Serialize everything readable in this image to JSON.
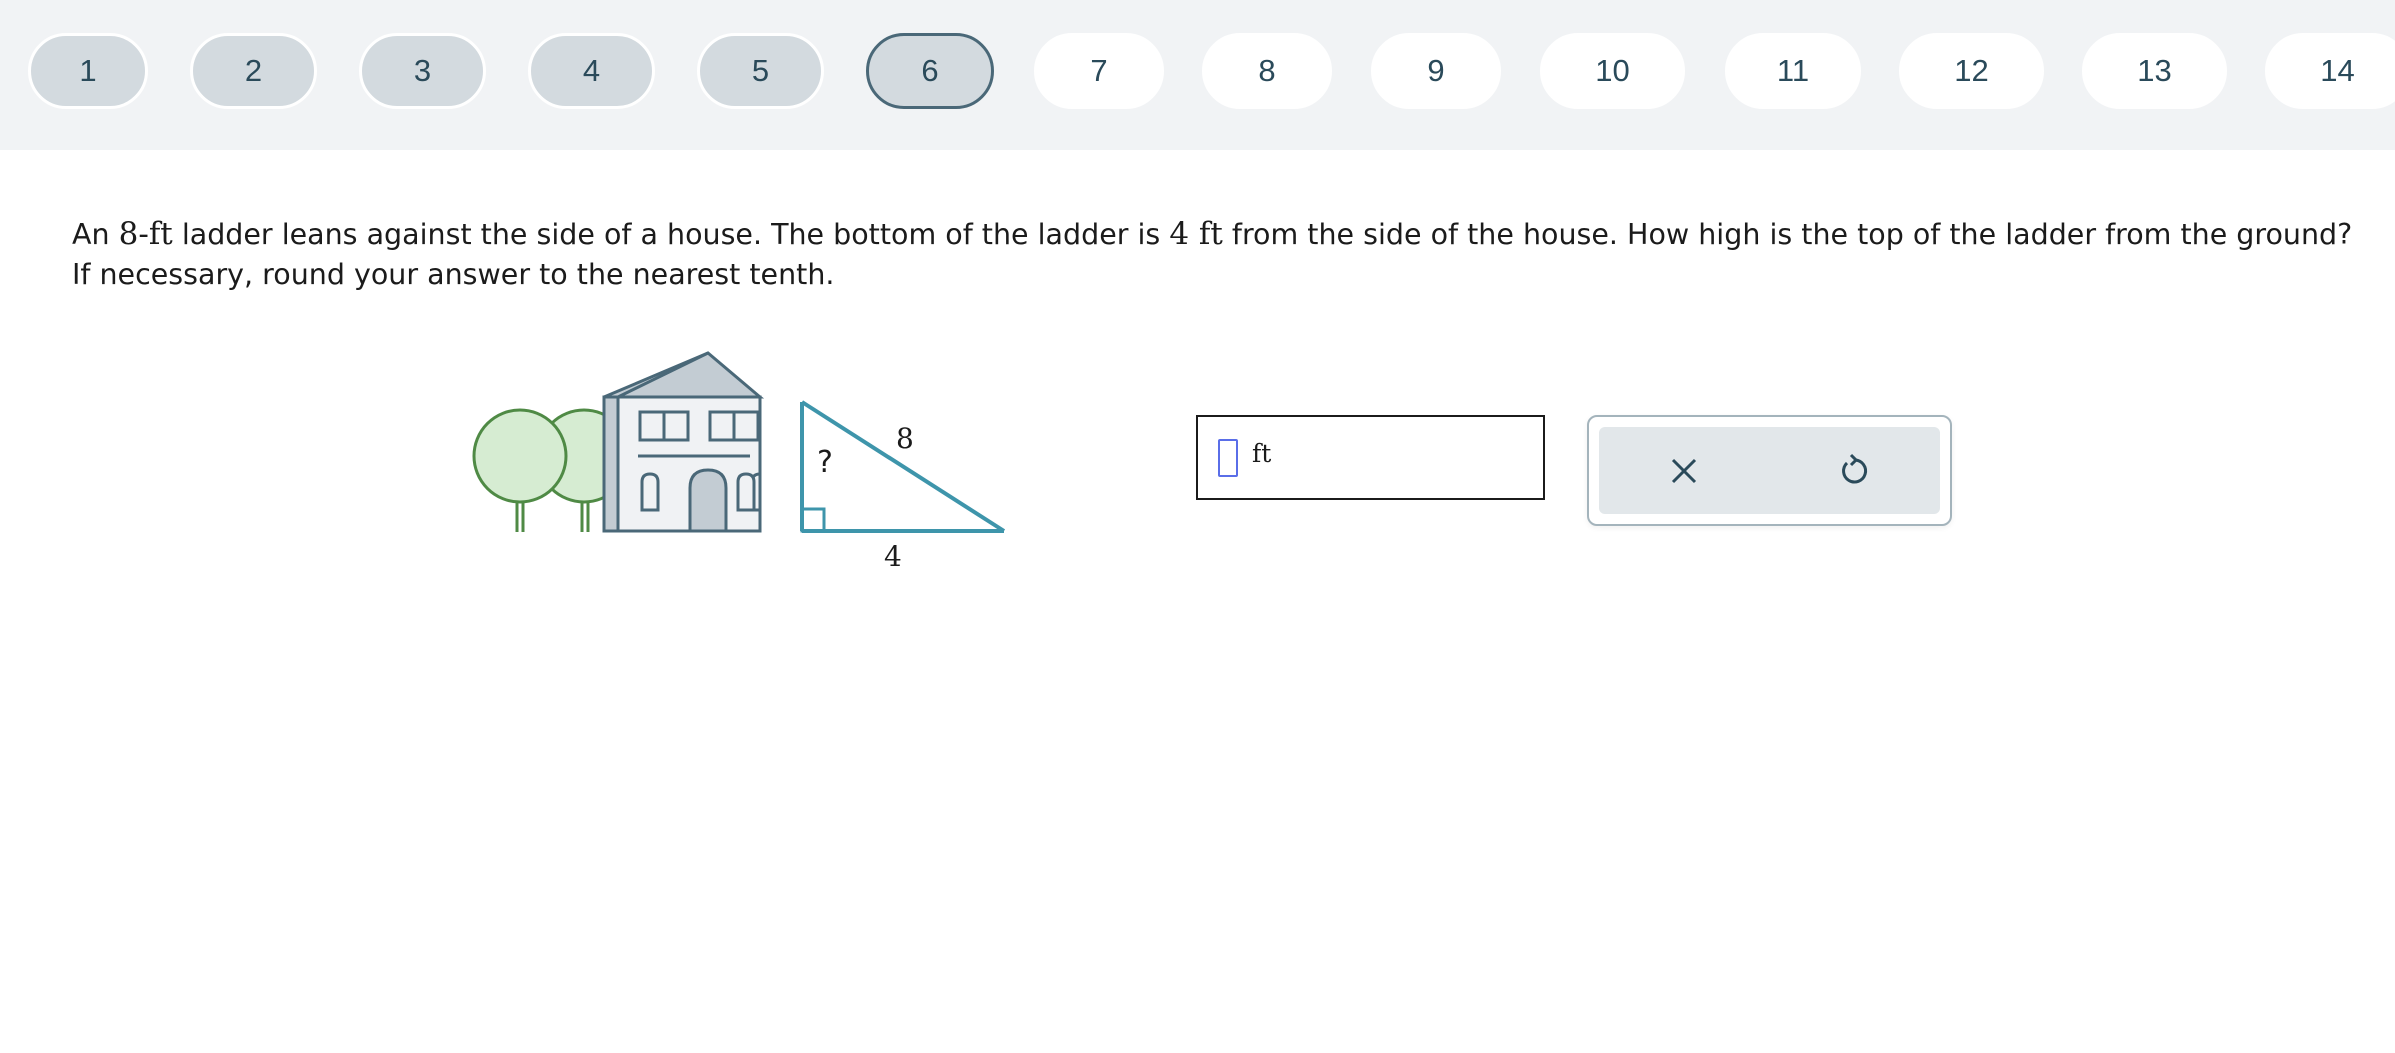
{
  "nav": {
    "items": [
      {
        "label": "1",
        "state": "done"
      },
      {
        "label": "2",
        "state": "done"
      },
      {
        "label": "3",
        "state": "done"
      },
      {
        "label": "4",
        "state": "done"
      },
      {
        "label": "5",
        "state": "done"
      },
      {
        "label": "6",
        "state": "current"
      },
      {
        "label": "7",
        "state": "todo"
      },
      {
        "label": "8",
        "state": "todo"
      },
      {
        "label": "9",
        "state": "todo"
      },
      {
        "label": "10",
        "state": "todo"
      },
      {
        "label": "11",
        "state": "todo"
      },
      {
        "label": "12",
        "state": "todo"
      },
      {
        "label": "13",
        "state": "todo"
      },
      {
        "label": "14",
        "state": "todo"
      }
    ]
  },
  "question": {
    "part1": "An ",
    "ladder_length": "8-ft",
    "part2": " ladder leans against the side of a house. The bottom of the ladder is ",
    "distance": "4 ft",
    "part3": " from the side of the house. How high is the top of the ladder from the ground?",
    "line2": "If necessary, round your answer to the nearest tenth."
  },
  "figure": {
    "hypotenuse_label": "8",
    "base_label": "4",
    "height_label": "?"
  },
  "answer": {
    "value": "",
    "unit": "ft"
  },
  "tools": {
    "clear_icon": "close-icon",
    "undo_icon": "undo-icon"
  },
  "colors": {
    "done_pill": "#d3dadf",
    "current_border": "#4a6878",
    "ladder": "#3e95ab",
    "house_stroke": "#4a6878",
    "tree_stroke": "#4f8a45",
    "tree_fill": "#d6ecd2"
  }
}
